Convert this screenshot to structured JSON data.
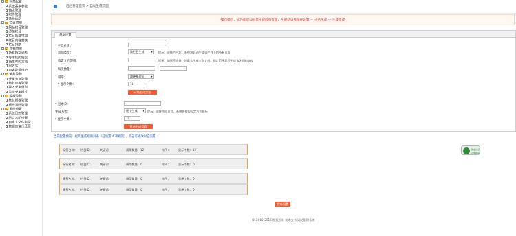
{
  "sidebar": {
    "groups": [
      {
        "label": "网站配置",
        "items": [
          "系统基本参数",
          "站点管理",
          "附件管理",
          "备份还原"
        ]
      },
      {
        "label": "栏目管理",
        "items": [
          "网站栏目管理",
          "添加栏目",
          "栏目批量增加",
          "栏目内容替换",
          "栏目排序"
        ]
      },
      {
        "label": "文档管理",
        "items": [
          "所有档案列表",
          "等审核的档案",
          "我发布的文档",
          "回收站",
          "内容批量维护"
        ]
      },
      {
        "label": "采集管理",
        "items": [
          "采集节点管理",
          "临时内容管理",
          "导入采集规则",
          "监控采集模式"
        ]
      },
      {
        "label": "模板管理",
        "items": [
          "默认模板管理",
          "标签源码管理"
        ]
      },
      {
        "label": "系统设置",
        "items": [
          "系统日志管理",
          "图片水印设置",
          "自定义文件类型",
          "数据库备份还原"
        ]
      }
    ]
  },
  "breadcrumb": "后台管理首页 > 自动生成页面",
  "notice": "操作提示：本功能可以批量生成静态页面，生成前请先保存设置 — 点击生成 — 生成完成",
  "panel": {
    "tab_label": "基本设置",
    "row1_label": "* 栏目名称：",
    "row1_value": "",
    "row2_label": "页面类型：",
    "row2_select": "按栏目生成",
    "row2_tip": "提示：选择栏目后，系统将自动生成该栏目下的所有页面",
    "row3_label": "指定文档范围：",
    "row3_tip": "提示：如果不选择，将默认生成全部文档，指定范围后只生成该区间的文档",
    "row4_label": "每页数量：",
    "row5_label": "排序：",
    "row5_select": "按更新时间",
    "row6_label": "* 显示个数：",
    "row6_value": "10",
    "btn1_label": "开始生成页面",
    "row7_label": "* 起始ID：",
    "row8_label": "生成方式：",
    "row8_select": "逐个生成",
    "row8_tip": "提示：选择生成方式，系统将按照设定方式执行",
    "row9_label": "* 显示个数：",
    "row9_value": "14",
    "btn2_label": "开始生成页面"
  },
  "preview": {
    "title": "当前配置预览：栏目生成规则列表（已设置 4 项规则），点击可修改对应设置",
    "cards": [
      {
        "a": "标签名称：",
        "b": "栏目ID：",
        "c": "关键词：",
        "d": "调用数量：12",
        "e": "排序：",
        "f": "显示个数：12"
      },
      {
        "a": "标签名称：",
        "b": "栏目ID：",
        "c": "关键词：",
        "d": "调用数量：0",
        "e": "排序：",
        "f": "显示个数：0"
      },
      {
        "a": "标签名称：",
        "b": "栏目ID：",
        "c": "关键词：",
        "d": "调用数量：0",
        "e": "排序：",
        "f": "显示个数：0"
      },
      {
        "a": "标签名称：",
        "b": "栏目ID：",
        "c": "关键词：",
        "d": "调用数量：0",
        "e": "排序：",
        "f": "显示个数：0"
      }
    ]
  },
  "badge": {
    "line1": "安全认证",
    "line2": "可信网站"
  },
  "submit_label": "保存设置",
  "footer": "© 2010-2015 版权所有 技术支持 网站管理系统"
}
